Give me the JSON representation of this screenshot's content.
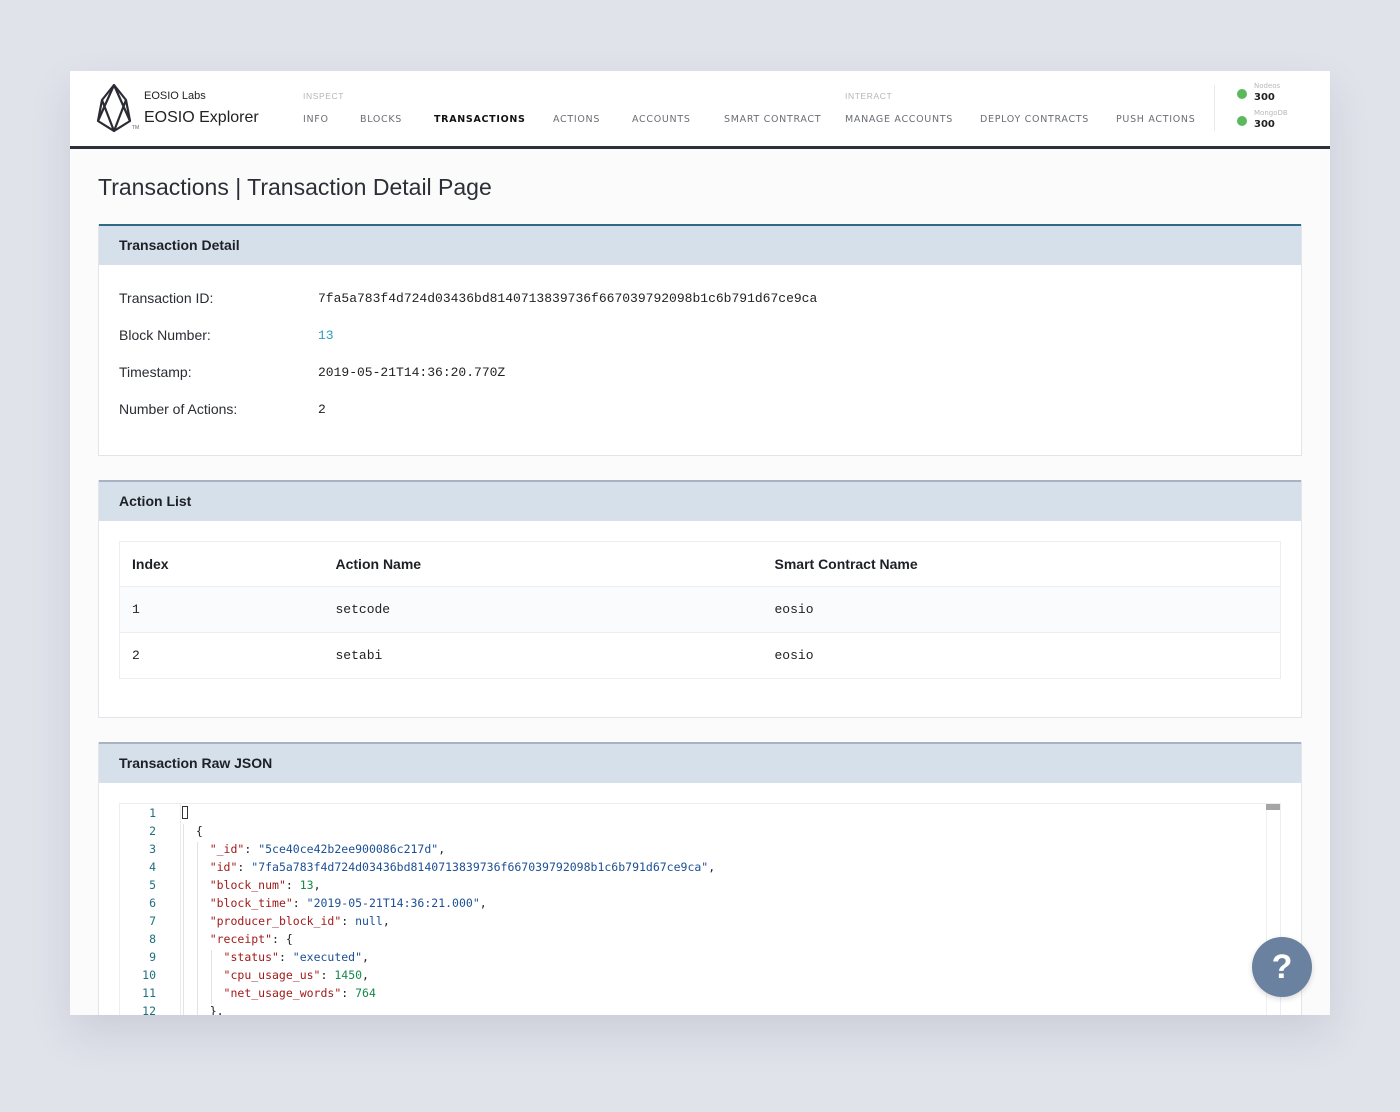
{
  "header": {
    "brand_small": "EOSIO Labs",
    "brand_big": "EOSIO Explorer",
    "tm": "TM",
    "nav_groups": {
      "inspect_label": "INSPECT",
      "interact_label": "INTERACT"
    },
    "nav": [
      {
        "label": "INFO",
        "active": false
      },
      {
        "label": "BLOCKS",
        "active": false
      },
      {
        "label": "TRANSACTIONS",
        "active": true
      },
      {
        "label": "ACTIONS",
        "active": false
      },
      {
        "label": "ACCOUNTS",
        "active": false
      },
      {
        "label": "SMART CONTRACT",
        "active": false
      },
      {
        "label": "MANAGE ACCOUNTS",
        "active": false
      },
      {
        "label": "DEPLOY CONTRACTS",
        "active": false
      },
      {
        "label": "PUSH ACTIONS",
        "active": false
      }
    ],
    "status": [
      {
        "label": "Nodeos",
        "value": "300",
        "color": "#5cb85c"
      },
      {
        "label": "MongoDB",
        "value": "300",
        "color": "#5cb85c"
      }
    ]
  },
  "page_title": "Transactions | Transaction Detail Page",
  "transaction_detail": {
    "title": "Transaction Detail",
    "rows": [
      {
        "label": "Transaction ID:",
        "value": "7fa5a783f4d724d03436bd8140713839736f667039792098b1c6b791d67ce9ca"
      },
      {
        "label": "Block Number:",
        "value": "13"
      },
      {
        "label": "Timestamp:",
        "value": "2019-05-21T14:36:20.770Z"
      },
      {
        "label": "Number of Actions:",
        "value": "2"
      }
    ]
  },
  "action_list": {
    "title": "Action List",
    "columns": [
      "Index",
      "Action Name",
      "Smart Contract Name"
    ],
    "rows": [
      {
        "index": "1",
        "action": "setcode",
        "contract": "eosio"
      },
      {
        "index": "2",
        "action": "setabi",
        "contract": "eosio"
      }
    ]
  },
  "raw_json": {
    "title": "Transaction Raw JSON",
    "line_numbers": [
      "1",
      "2",
      "3",
      "4",
      "5",
      "6",
      "7",
      "8",
      "9",
      "10",
      "11",
      "12"
    ],
    "lines": {
      "l3_key": "\"_id\"",
      "l3_val": "\"5ce40ce42b2ee900086c217d\"",
      "l4_key": "\"id\"",
      "l4_val": "\"7fa5a783f4d724d03436bd8140713839736f667039792098b1c6b791d67ce9ca\"",
      "l5_key": "\"block_num\"",
      "l5_val": "13",
      "l6_key": "\"block_time\"",
      "l6_val": "\"2019-05-21T14:36:21.000\"",
      "l7_key": "\"producer_block_id\"",
      "l7_val": "null",
      "l8_key": "\"receipt\"",
      "l9_key": "\"status\"",
      "l9_val": "\"executed\"",
      "l10_key": "\"cpu_usage_us\"",
      "l10_val": "1450",
      "l11_key": "\"net_usage_words\"",
      "l11_val": "764"
    }
  },
  "help_button": {
    "label": "?"
  }
}
